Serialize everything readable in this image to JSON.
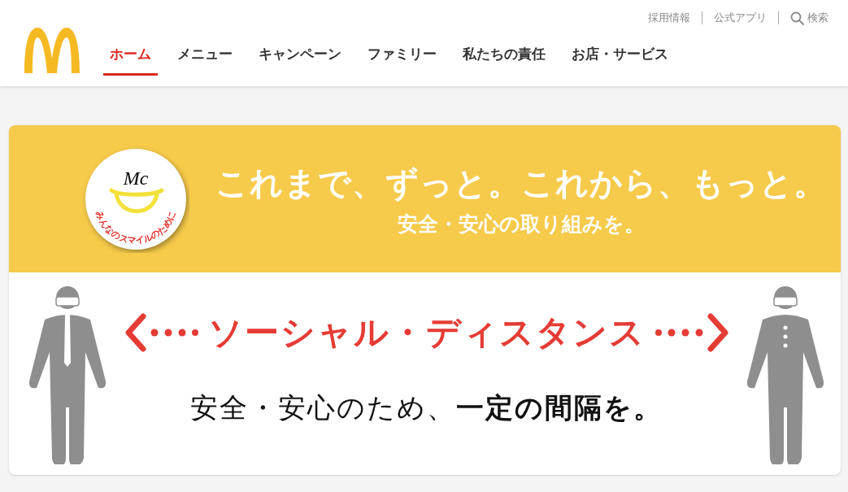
{
  "header": {
    "utility_links": [
      {
        "label": "採用情報"
      },
      {
        "label": "公式アプリ"
      }
    ],
    "search": {
      "label": "検索"
    },
    "nav": [
      {
        "label": "ホーム",
        "selected": true
      },
      {
        "label": "メニュー",
        "selected": false
      },
      {
        "label": "キャンペーン",
        "selected": false
      },
      {
        "label": "ファミリー",
        "selected": false
      },
      {
        "label": "私たちの責任",
        "selected": false
      },
      {
        "label": "お店・サービス",
        "selected": false
      }
    ]
  },
  "banner": {
    "badge": {
      "mark": "Mc",
      "caption": "みんなのスマイルのために"
    },
    "headline": "これまで、ずっと。これから、もっと。",
    "subheadline": "安全・安心の取り組みを。",
    "distancing": {
      "title": "ソーシャル・ディスタンス",
      "message": "安全・安心のため、**一定の間隔を。**"
    }
  }
}
